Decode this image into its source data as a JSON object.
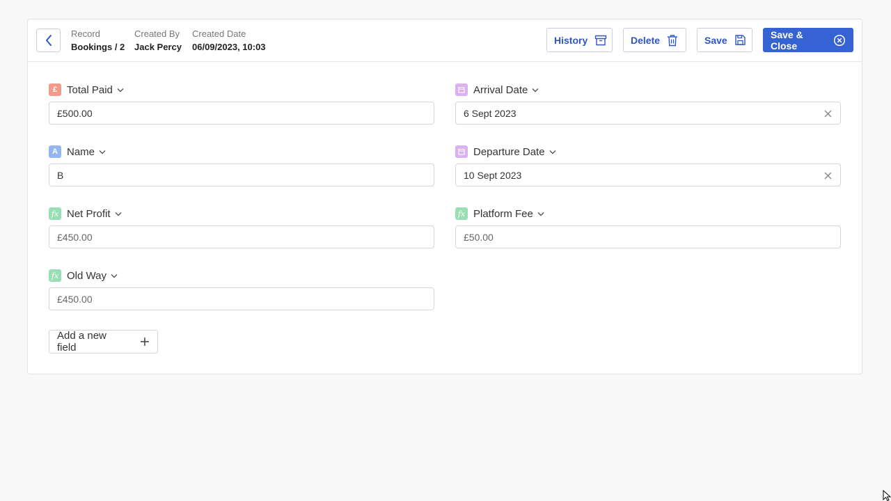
{
  "header": {
    "record_label": "Record",
    "record_value": "Bookings / 2",
    "created_by_label": "Created By",
    "created_by_value": "Jack Percy",
    "created_date_label": "Created Date",
    "created_date_value": "06/09/2023, 10:03",
    "buttons": {
      "history": "History",
      "delete": "Delete",
      "save": "Save",
      "save_close": "Save & Close"
    }
  },
  "fields": {
    "total_paid": {
      "label": "Total Paid",
      "icon": "pound-icon",
      "glyph": "£",
      "value": "£500.00"
    },
    "arrival_date": {
      "label": "Arrival Date",
      "icon": "calendar-icon",
      "value": "6 Sept 2023"
    },
    "name": {
      "label": "Name",
      "icon": "text-icon",
      "glyph": "A",
      "value": "B"
    },
    "departure_date": {
      "label": "Departure Date",
      "icon": "calendar-icon",
      "value": "10 Sept 2023"
    },
    "net_profit": {
      "label": "Net Profit",
      "icon": "formula-icon",
      "glyph": "fx",
      "value": "£450.00"
    },
    "platform_fee": {
      "label": "Platform Fee",
      "icon": "formula-icon",
      "glyph": "fx",
      "value": "£50.00"
    },
    "old_way": {
      "label": "Old Way",
      "icon": "formula-icon",
      "glyph": "fx",
      "value": "£450.00"
    }
  },
  "add_field_label": "Add a new field",
  "colors": {
    "primary": "#3563d3",
    "currency_icon": "#f29a8e",
    "date_icon": "#dcb2ee",
    "text_icon": "#95b6f4",
    "formula_icon": "#98dfb4"
  }
}
